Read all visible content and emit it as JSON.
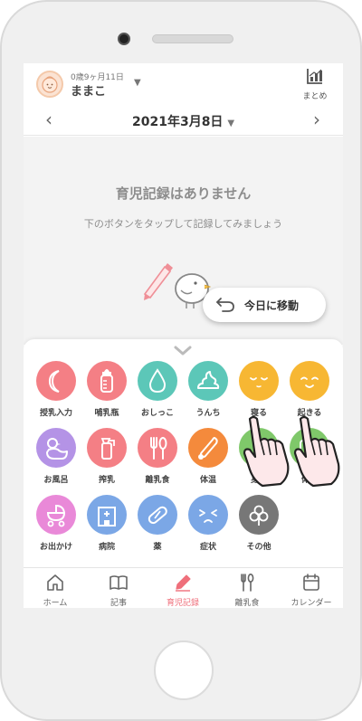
{
  "child": {
    "age": "0歳9ヶ月11日",
    "name": "ままこ"
  },
  "header": {
    "summary_label": "まとめ"
  },
  "date": {
    "label": "2021年3月8日"
  },
  "empty": {
    "title": "育児記録はありません",
    "hint": "下のボタンをタップして記録してみましょう"
  },
  "today_button": {
    "label": "今日に移動"
  },
  "records": [
    {
      "label": "授乳入力",
      "color": "#f47f85",
      "icon": "moon-icon"
    },
    {
      "label": "哺乳瓶",
      "color": "#f47f85",
      "icon": "bottle-icon"
    },
    {
      "label": "おしっこ",
      "color": "#5cc7b8",
      "icon": "drop-icon"
    },
    {
      "label": "うんち",
      "color": "#5cc7b8",
      "icon": "poop-icon"
    },
    {
      "label": "寝る",
      "color": "#f7b733",
      "icon": "sleep-face-icon"
    },
    {
      "label": "起きる",
      "color": "#f7b733",
      "icon": "smile-face-icon"
    },
    {
      "label": "お風呂",
      "color": "#b493e6",
      "icon": "duck-icon"
    },
    {
      "label": "搾乳",
      "color": "#f47f85",
      "icon": "pump-icon"
    },
    {
      "label": "離乳食",
      "color": "#f47f85",
      "icon": "utensils-icon"
    },
    {
      "label": "体温",
      "color": "#f48a3c",
      "icon": "thermometer-icon"
    },
    {
      "label": "身長",
      "color": "#7fc86a",
      "icon": "height-icon"
    },
    {
      "label": "体重",
      "color": "#7fc86a",
      "icon": "scale-icon"
    },
    {
      "label": "お出かけ",
      "color": "#e989d8",
      "icon": "stroller-icon"
    },
    {
      "label": "病院",
      "color": "#7ba7e6",
      "icon": "hospital-icon"
    },
    {
      "label": "薬",
      "color": "#7ba7e6",
      "icon": "pill-icon"
    },
    {
      "label": "症状",
      "color": "#7ba7e6",
      "icon": "sick-face-icon"
    },
    {
      "label": "その他",
      "color": "#777777",
      "icon": "clover-icon"
    }
  ],
  "tabs": [
    {
      "label": "ホーム",
      "icon": "home-icon"
    },
    {
      "label": "記事",
      "icon": "book-icon"
    },
    {
      "label": "育児記録",
      "icon": "pencil-icon",
      "active": true
    },
    {
      "label": "離乳食",
      "icon": "utensils-icon"
    },
    {
      "label": "カレンダー",
      "icon": "calendar-icon"
    }
  ]
}
